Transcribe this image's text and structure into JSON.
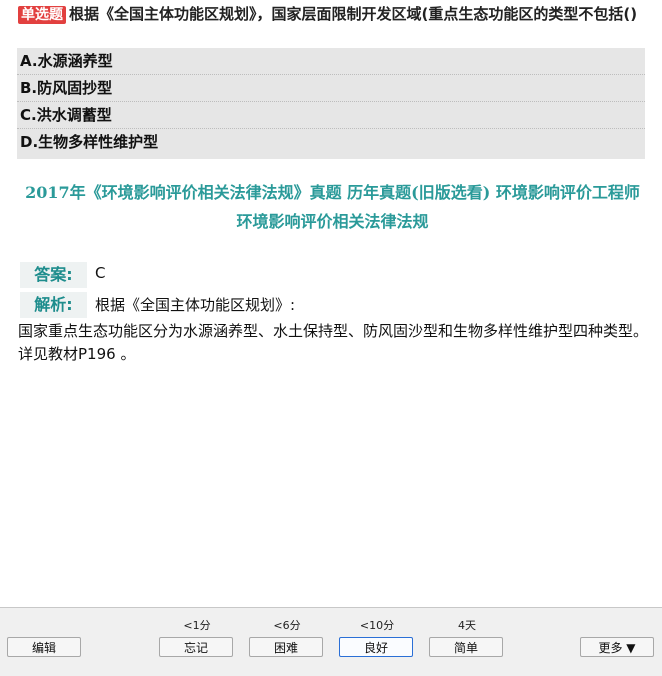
{
  "question": {
    "type_badge": "单选题",
    "text": "根据《全国主体功能区规划》，国家层面限制开发区域(重点生态功能区的类型不包括()"
  },
  "options": [
    "A.水源涵养型",
    "B.防风固抄型",
    "C.洪水调蓄型",
    "D.生物多样性维护型"
  ],
  "source": "2017年《环境影响评价相关法律法规》真题 历年真题(旧版选看) 环境影响评价工程师 环境影响评价相关法律法规",
  "answer": {
    "label": "答案:",
    "value": "C"
  },
  "analysis": {
    "label": "解析:",
    "head": "根据《全国主体功能区规划》:",
    "lines": [
      "国家重点生态功能区分为水源涵养型、水土保持型、防风固沙型和生物多样性维护型四种类型。",
      "详见教材P196 。"
    ]
  },
  "review_bar": {
    "edit_label": "编辑",
    "intervals": [
      "<1分",
      "<6分",
      "<10分",
      "4天"
    ],
    "buttons": [
      "忘记",
      "困难",
      "良好",
      "简单"
    ],
    "more_label": "更多 ▼"
  }
}
